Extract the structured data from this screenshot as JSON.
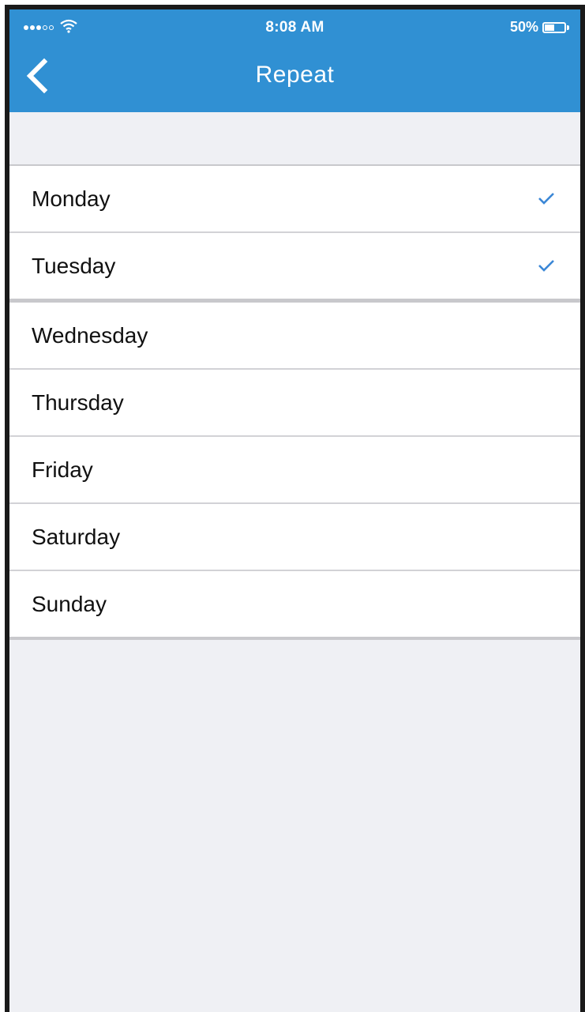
{
  "status_bar": {
    "time": "8:08 AM",
    "battery": "50%",
    "signal_icon": "signal-dots-icon",
    "wifi_icon": "wifi-icon",
    "battery_level": 0.5
  },
  "nav": {
    "title": "Repeat",
    "back_icon": "chevron-left-icon"
  },
  "days": [
    {
      "label": "Monday",
      "checked": true
    },
    {
      "label": "Tuesday",
      "checked": true
    },
    {
      "label": "Wednesday",
      "checked": false
    },
    {
      "label": "Thursday",
      "checked": false
    },
    {
      "label": "Friday",
      "checked": false
    },
    {
      "label": "Saturday",
      "checked": false
    },
    {
      "label": "Sunday",
      "checked": false
    }
  ],
  "colors": {
    "header": "#3090d3",
    "background": "#eff0f4",
    "checkmark": "#3b87d6"
  }
}
